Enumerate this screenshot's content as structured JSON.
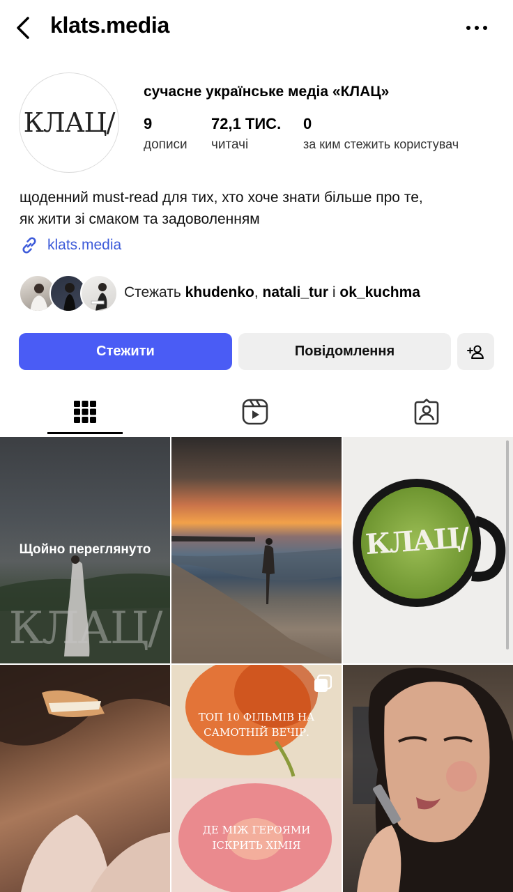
{
  "header": {
    "title": "klats.media"
  },
  "profile": {
    "avatar_text": "КЛАЦ/",
    "name": "сучасне українське медіа «КЛАЦ»",
    "stats": [
      {
        "value": "9",
        "label": "дописи"
      },
      {
        "value": "72,1 ТИС.",
        "label": "читачі"
      },
      {
        "value": "0",
        "label": "за ким стежить користувач"
      }
    ],
    "bio_line1": "щоденний must-read для тих, хто хоче знати більше про те,",
    "bio_line2": "як жити зі смаком та задоволенням",
    "link": "klats.media"
  },
  "followed_by": {
    "prefix": "Стежать ",
    "user1": "khudenko",
    "sep1": ", ",
    "user2": "natali_tur",
    "sep2": " і ",
    "user3": "ok_kuchma"
  },
  "actions": {
    "follow_label": "Стежити",
    "message_label": "Повідомлення"
  },
  "posts": {
    "post1_overlay": "Щойно переглянуто",
    "post1_watermark": "КЛАЦ/",
    "post3_logo": "КЛАЦ/",
    "post5_text_top": "ТОП 10 ФІЛЬМІВ НА САМОТНІЙ ВЕЧІР.",
    "post5_text_bottom": "ДЕ МІЖ ГЕРОЯМИ ІСКРИТЬ ХІМІЯ"
  },
  "colors": {
    "accent": "#4a5cf5",
    "link": "#3d5bd9"
  }
}
